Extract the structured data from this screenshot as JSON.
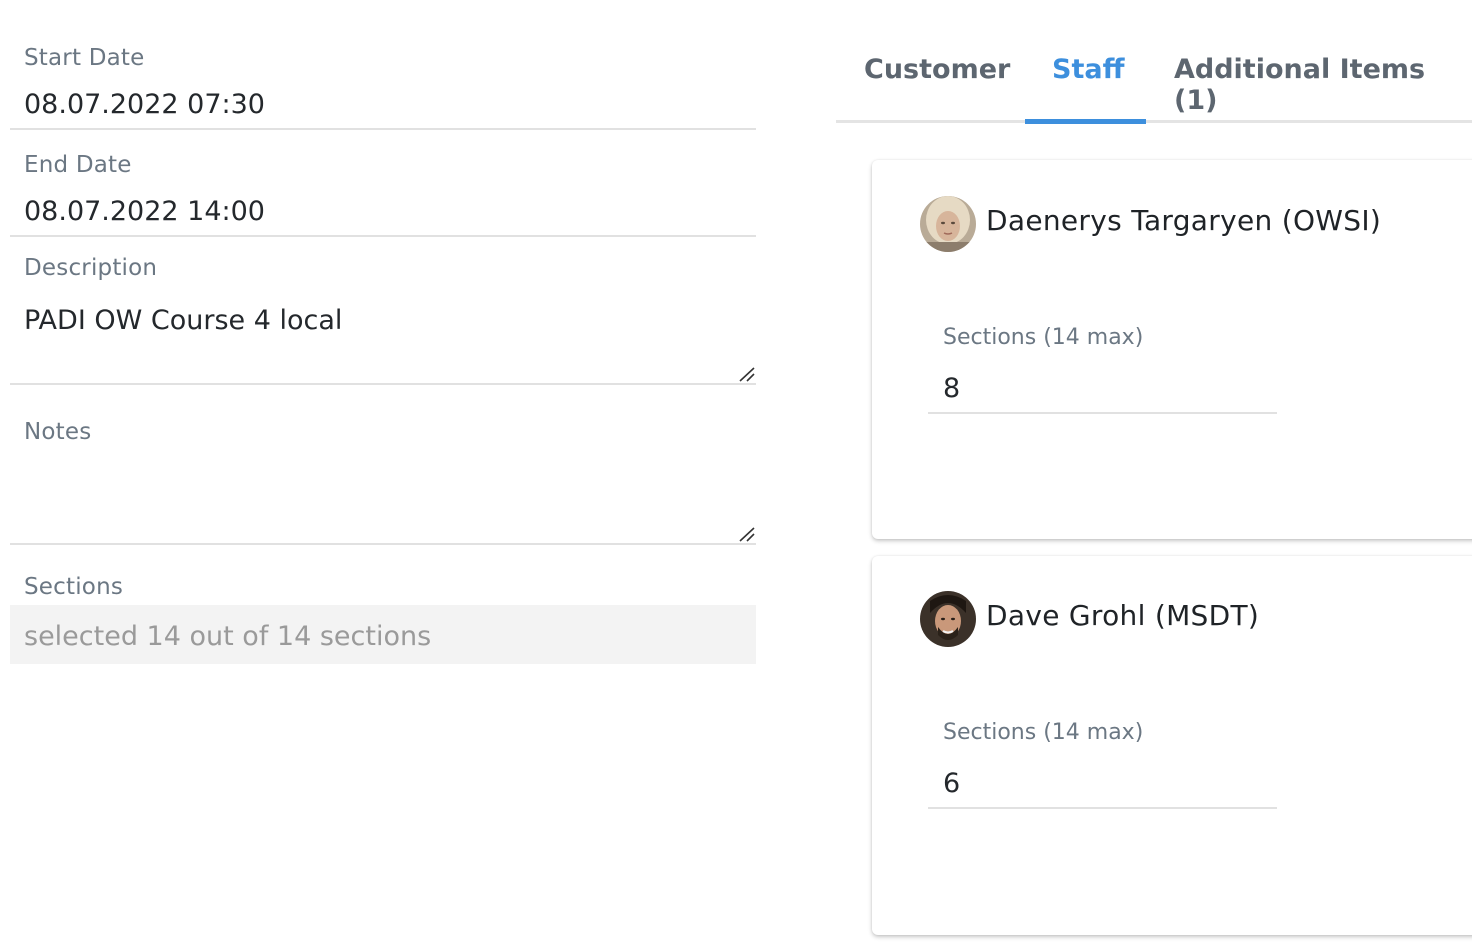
{
  "form": {
    "start_date": {
      "label": "Start Date",
      "value": "08.07.2022 07:30"
    },
    "end_date": {
      "label": "End Date",
      "value": "08.07.2022 14:00"
    },
    "description": {
      "label": "Description",
      "value": "PADI OW Course 4 local"
    },
    "notes": {
      "label": "Notes",
      "value": ""
    },
    "sections": {
      "label": "Sections",
      "value": "selected 14 out of 14 sections"
    }
  },
  "tabs": [
    {
      "label": "Customer",
      "active": false
    },
    {
      "label": "Staff",
      "active": true
    },
    {
      "label": "Additional Items (1)",
      "active": false
    }
  ],
  "staff": [
    {
      "name": "Daenerys Targaryen (OWSI)",
      "sections_label": "Sections (14 max)",
      "sections_value": "8",
      "avatar": "person-avatar-blonde"
    },
    {
      "name": "Dave Grohl (MSDT)",
      "sections_label": "Sections (14 max)",
      "sections_value": "6",
      "avatar": "person-avatar-dark-hair"
    }
  ],
  "colors": {
    "accent": "#3d8fdd",
    "label": "#6b7783",
    "text": "#24282c"
  }
}
